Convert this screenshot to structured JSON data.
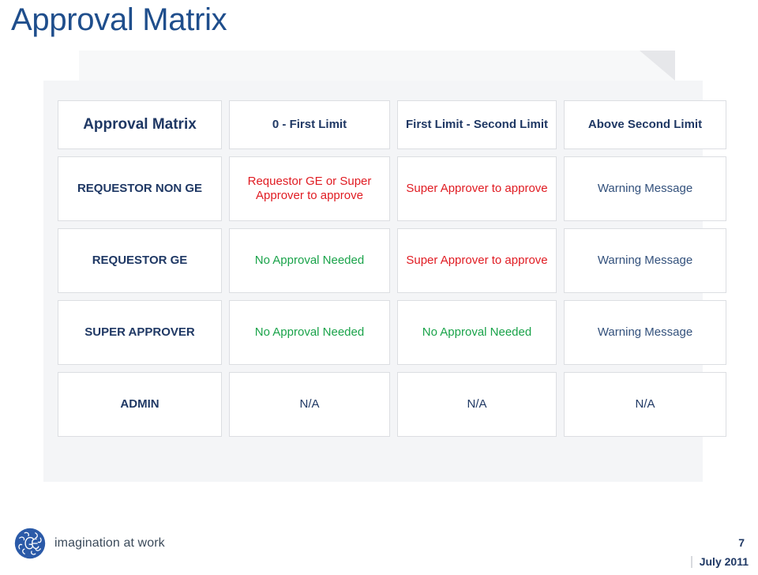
{
  "slide": {
    "title": "Approval Matrix",
    "page_number": "7",
    "date": "July 2011"
  },
  "branding": {
    "logo_name": "ge-monogram-logo",
    "tagline": "imagination at work",
    "logo_color": "#2b5aa8",
    "title_color": "#1f4e8c"
  },
  "colors": {
    "header_text": "#1f3864",
    "row_label": "#1f3864",
    "approval_required": "#e01b22",
    "no_approval": "#1aa34a",
    "warning": "#33517c",
    "not_applicable": "#1f3864",
    "cell_border": "#dcdee2",
    "slab": "#f4f5f7"
  },
  "matrix": {
    "corner_label": "Approval Matrix",
    "columns": [
      "0 - First Limit",
      "First Limit - Second Limit",
      "Above Second Limit"
    ],
    "rows": [
      {
        "label": "REQUESTOR NON GE",
        "cells": [
          {
            "text": "Requestor GE or Super Approver to approve",
            "style": "red"
          },
          {
            "text": "Super Approver to approve",
            "style": "red"
          },
          {
            "text": "Warning Message",
            "style": "warn"
          }
        ]
      },
      {
        "label": "REQUESTOR GE",
        "cells": [
          {
            "text": "No Approval Needed",
            "style": "green"
          },
          {
            "text": "Super Approver to approve",
            "style": "red"
          },
          {
            "text": "Warning Message",
            "style": "warn"
          }
        ]
      },
      {
        "label": "SUPER APPROVER",
        "cells": [
          {
            "text": "No Approval Needed",
            "style": "green"
          },
          {
            "text": "No Approval Needed",
            "style": "green"
          },
          {
            "text": "Warning Message",
            "style": "warn"
          }
        ]
      },
      {
        "label": "ADMIN",
        "cells": [
          {
            "text": "N/A",
            "style": "na"
          },
          {
            "text": "N/A",
            "style": "na"
          },
          {
            "text": "N/A",
            "style": "na"
          }
        ]
      }
    ]
  }
}
